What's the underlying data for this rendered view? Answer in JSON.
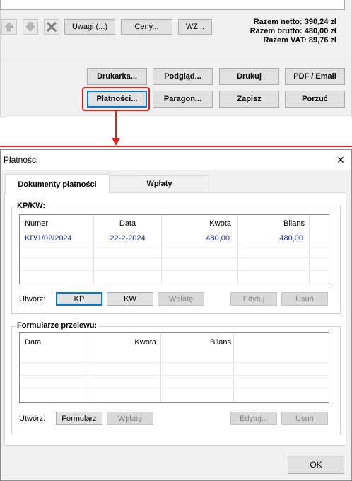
{
  "top": {
    "uwagi_label": "Uwagi (...)",
    "ceny_label": "Ceny...",
    "wz_label": "WZ...",
    "razem_netto": "Razem netto: 390,24 zł",
    "razem_brutto": "Razem brutto: 480,00 zł",
    "razem_vat": "Razem VAT: 89,76 zł",
    "buttons": {
      "drukarka": "Drukarka...",
      "podglad": "Podgląd...",
      "drukuj": "Drukuj",
      "pdf_email": "PDF / Email",
      "platnosci": "Płatności...",
      "paragon": "Paragon...",
      "zapisz": "Zapisz",
      "porzuc": "Porzuć"
    }
  },
  "dialog": {
    "title": "Płatności",
    "close_glyph": "✕",
    "tabs": [
      "Dokumenty płatności",
      "Wpłaty"
    ],
    "kp_section": {
      "legend": "KP/KW:",
      "columns": [
        "Numer",
        "Data",
        "Kwota",
        "Bilans"
      ],
      "rows": [
        {
          "numer": "KP/1/02/2024",
          "data": "22-2-2024",
          "kwota": "480,00",
          "bilans": "480,00"
        }
      ],
      "create_label": "Utwórz:",
      "btn_kp": "KP",
      "btn_kw": "KW",
      "btn_wplate": "Wpłatę",
      "btn_edytuj": "Edytuj",
      "btn_usun": "Usuń"
    },
    "transfer_section": {
      "legend": "Formularze przelewu:",
      "columns": [
        "Data",
        "Kwota",
        "Bilans"
      ],
      "create_label": "Utwórz:",
      "btn_formularz": "Formularz",
      "btn_wplate": "Wpłatę",
      "btn_edytuj": "Edytuj...",
      "btn_usun": "Usuń"
    },
    "ok_label": "OK"
  },
  "colors": {
    "highlight_red": "#e0201e",
    "selected_blue": "#0078d7",
    "row_text_blue": "#1b2a8c"
  }
}
